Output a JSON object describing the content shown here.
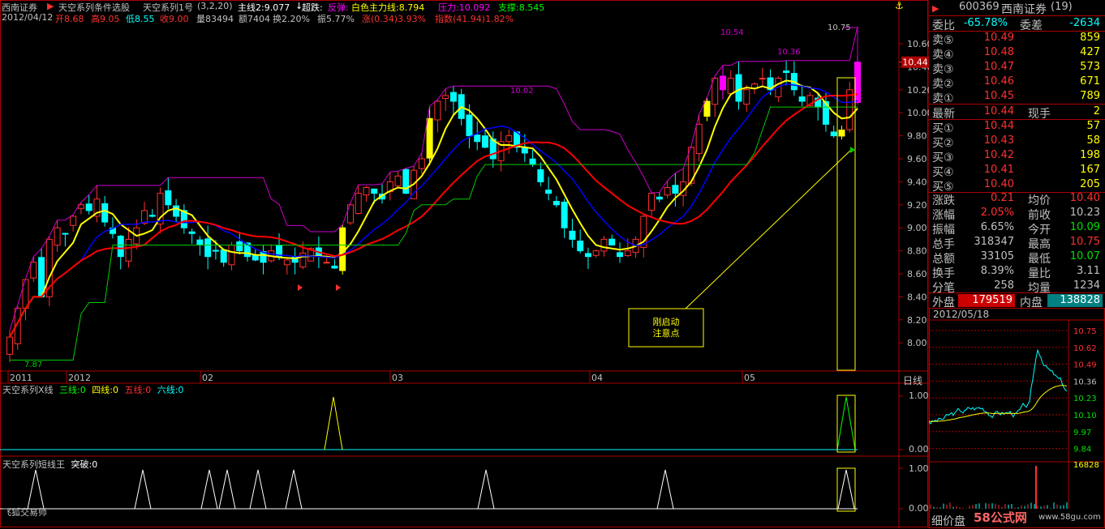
{
  "header": {
    "broker": "西南证券",
    "formula": "天空系列条件选股",
    "formula2": "天空系列1号",
    "params": "(3,2,20)",
    "main_line": "主线2:9.077",
    "arrow_down": "↓",
    "chao_die": "超跌:",
    "fan_tan": "反弹:",
    "white_line": "白色主力线:8.794",
    "pressure": "压力:10.092",
    "support": "支撑:8.545",
    "date": "2012/04/12",
    "open": "开8.68",
    "high": "高9.05",
    "low": "低8.55",
    "close": "收9.00",
    "volume": "量83494",
    "amount": "额7404",
    "turnover": "换2.20%",
    "amplitude": "振5.77%",
    "change": "涨(0.34)3.93%",
    "index": "指数(41.94)1.82%"
  },
  "main_chart": {
    "price_labels": [
      "10.60",
      "10.40",
      "10.20",
      "10.00",
      "9.80",
      "9.60",
      "9.40",
      "9.20",
      "9.00",
      "8.80",
      "8.60",
      "8.40",
      "8.20",
      "8.00"
    ],
    "current_price": "10.44",
    "annotations": [
      "10.75",
      "10.54",
      "10.36",
      "10.02",
      "7.87"
    ],
    "date_labels": [
      "2011",
      "2012",
      "02",
      "03",
      "04",
      "05"
    ],
    "period": "日线",
    "note_box": "刚启动\n注意点"
  },
  "sub1": {
    "title": "天空系列X线",
    "l1": "三线:0",
    "l2": "四线:0",
    "l3": "五线:0",
    "l4": "六线:0",
    "ymax": "1.00",
    "ymin": "0.00"
  },
  "sub2": {
    "title": "天空系列短线王",
    "l1": "突破:0",
    "ymax": "1.00",
    "ymin": "0.00",
    "footer": "飞狐交易师"
  },
  "order_book": {
    "code": "600369",
    "name": "西南证券",
    "count": "(19)",
    "wei_bi_label": "委比",
    "wei_bi": "-65.78%",
    "wei_cha_label": "委差",
    "wei_cha": "-2634",
    "sells": [
      {
        "label": "卖⑤",
        "price": "10.49",
        "vol": "859"
      },
      {
        "label": "卖④",
        "price": "10.48",
        "vol": "427"
      },
      {
        "label": "卖③",
        "price": "10.47",
        "vol": "573"
      },
      {
        "label": "卖②",
        "price": "10.46",
        "vol": "671"
      },
      {
        "label": "卖①",
        "price": "10.45",
        "vol": "789"
      }
    ],
    "last_label": "最新",
    "last": "10.44",
    "now_label": "现手",
    "now": "2",
    "buys": [
      {
        "label": "买①",
        "price": "10.44",
        "vol": "57"
      },
      {
        "label": "买②",
        "price": "10.43",
        "vol": "58"
      },
      {
        "label": "买③",
        "price": "10.42",
        "vol": "198"
      },
      {
        "label": "买④",
        "price": "10.41",
        "vol": "167"
      },
      {
        "label": "买⑤",
        "price": "10.40",
        "vol": "205"
      }
    ],
    "stats": [
      {
        "a": "涨跌",
        "av": "0.21",
        "b": "均价",
        "bv": "10.40",
        "ac": "#ff3030",
        "bc": "#ff3030"
      },
      {
        "a": "涨幅",
        "av": "2.05%",
        "b": "前收",
        "bv": "10.23",
        "ac": "#ff3030",
        "bc": "#c0c0c0"
      },
      {
        "a": "振幅",
        "av": "6.65%",
        "b": "今开",
        "bv": "10.09",
        "ac": "#c0c0c0",
        "bc": "#00e000"
      },
      {
        "a": "总手",
        "av": "318347",
        "b": "最高",
        "bv": "10.75",
        "ac": "#c0c0c0",
        "bc": "#ff3030"
      },
      {
        "a": "总额",
        "av": "33105",
        "b": "最低",
        "bv": "10.07",
        "ac": "#c0c0c0",
        "bc": "#00e000"
      },
      {
        "a": "换手",
        "av": "8.39%",
        "b": "量比",
        "bv": "3.11",
        "ac": "#c0c0c0",
        "bc": "#c0c0c0"
      },
      {
        "a": "分笔",
        "av": "258",
        "b": "均量",
        "bv": "1234",
        "ac": "#c0c0c0",
        "bc": "#c0c0c0"
      }
    ],
    "wai_label": "外盘",
    "wai": "179519",
    "nei_label": "内盘",
    "nei": "138828"
  },
  "mini": {
    "date": "2012/05/18",
    "prices": [
      "10.75",
      "10.62",
      "10.49",
      "10.36",
      "10.23",
      "10.10",
      "9.97",
      "9.84"
    ],
    "vol_top": "16828",
    "footer": "细价盘",
    "watermark": "58公式网",
    "url": "www.58gu.com"
  }
}
